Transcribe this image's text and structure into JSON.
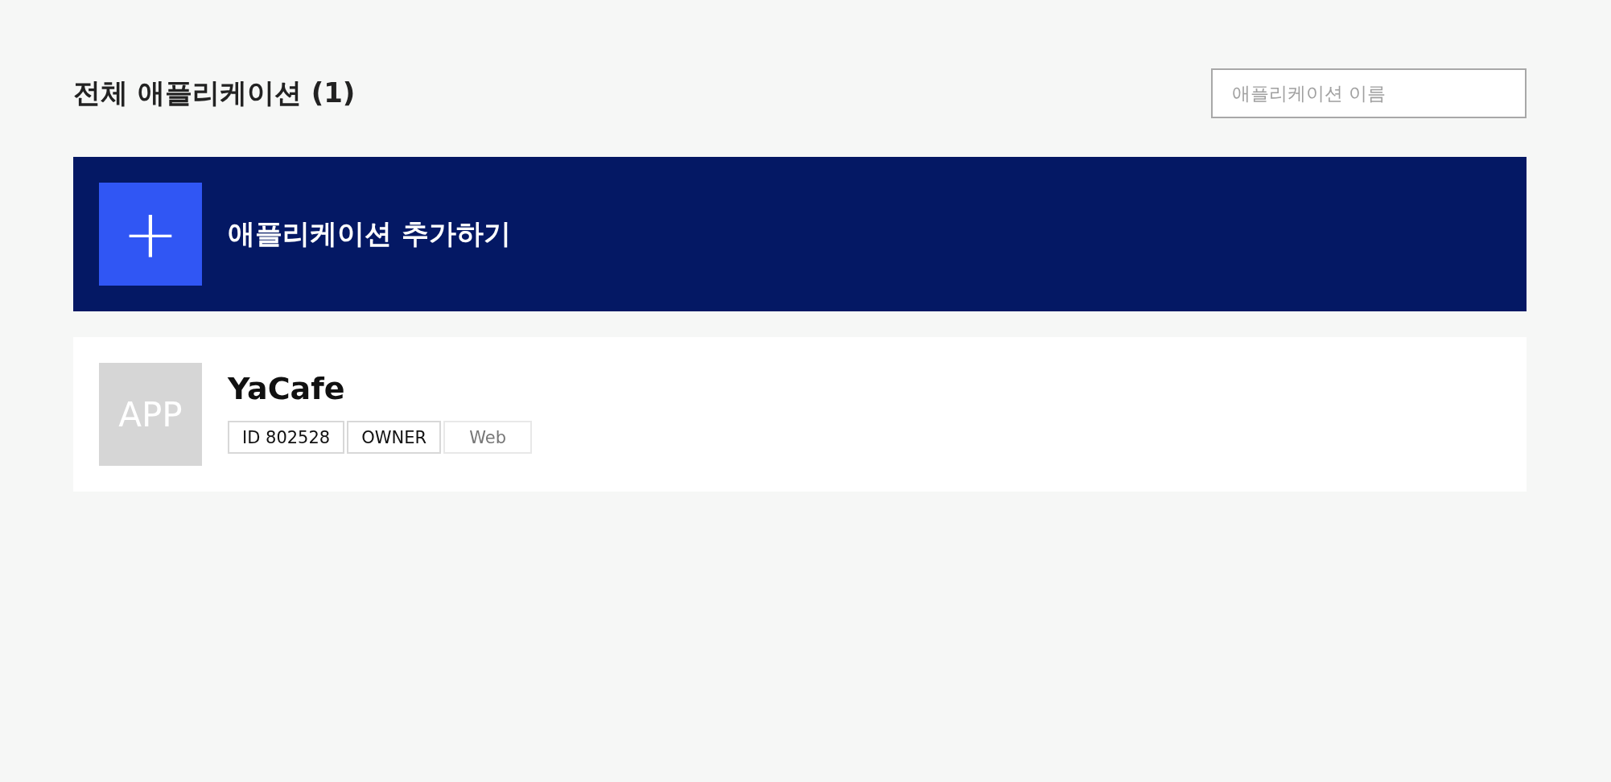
{
  "header": {
    "title": "전체 애플리케이션 (1)",
    "search": {
      "placeholder": "애플리케이션 이름"
    }
  },
  "add_banner": {
    "icon": "+",
    "label": "애플리케이션 추가하기"
  },
  "apps": [
    {
      "logo": "APP",
      "name": "YaCafe",
      "tags": [
        {
          "label": "ID 802528",
          "muted": false
        },
        {
          "label": "OWNER",
          "muted": false
        },
        {
          "label": "Web",
          "muted": true
        }
      ]
    }
  ]
}
